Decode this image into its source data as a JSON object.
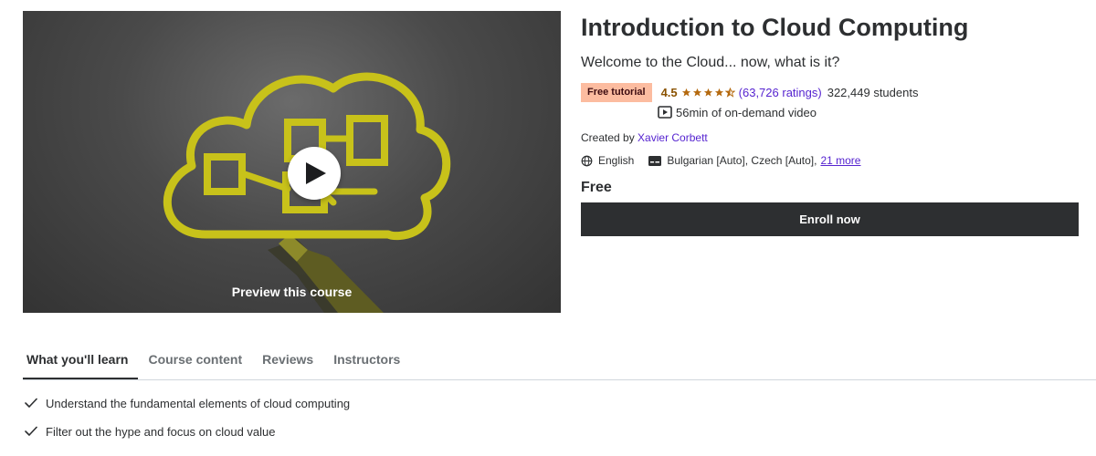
{
  "preview": {
    "label": "Preview this course",
    "play_icon": "play-icon"
  },
  "course": {
    "title": "Introduction to Cloud Computing",
    "subtitle": "Welcome to the Cloud... now, what is it?",
    "badge": "Free tutorial",
    "rating": "4.5",
    "rating_value": 4.5,
    "rating_count": "(63,726 ratings)",
    "students": "322,449 students",
    "video_length": "56min of on-demand video",
    "created_prefix": "Created by",
    "instructor": "Xavier Corbett",
    "language": "English",
    "captions": "Bulgarian [Auto], Czech [Auto],",
    "captions_more": "21 more",
    "price": "Free",
    "enroll_label": "Enroll now"
  },
  "tabs": [
    {
      "label": "What you'll learn",
      "active": true
    },
    {
      "label": "Course content",
      "active": false
    },
    {
      "label": "Reviews",
      "active": false
    },
    {
      "label": "Instructors",
      "active": false
    }
  ],
  "learn": [
    "Understand the fundamental elements of cloud computing",
    "Filter out the hype and focus on cloud value"
  ],
  "colors": {
    "accent": "#5624d0",
    "star": "#b4690e",
    "badge_bg": "#fcbca0",
    "button_bg": "#2d2f31",
    "highlighter": "#c8c21a"
  }
}
